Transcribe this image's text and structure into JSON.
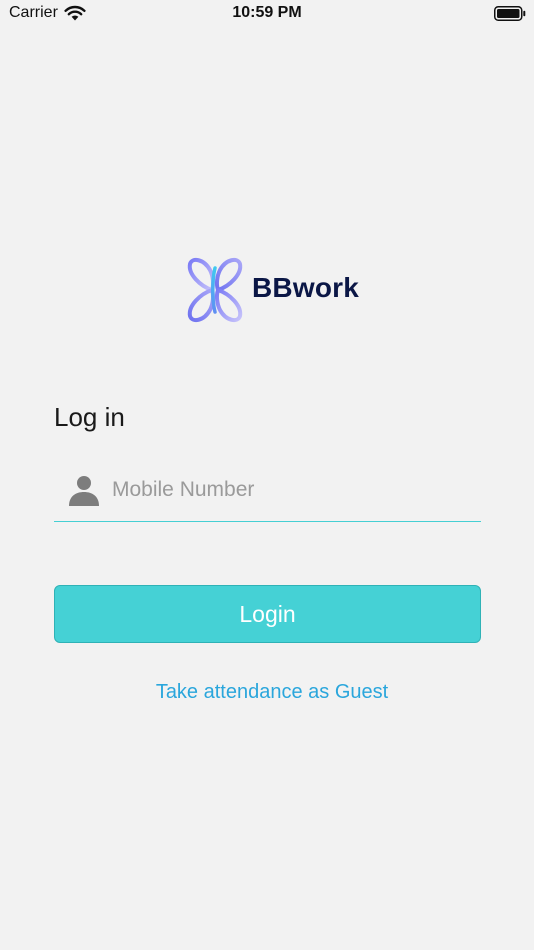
{
  "status_bar": {
    "carrier": "Carrier",
    "time": "10:59 PM"
  },
  "logo": {
    "text": "BBwork",
    "mark_colors": [
      "#7b7bf5",
      "#a9a6f7",
      "#3ec9f0"
    ]
  },
  "login": {
    "heading": "Log in",
    "mobile_placeholder": "Mobile Number",
    "mobile_value": "",
    "button_label": "Login",
    "guest_link": "Take attendance as Guest"
  },
  "colors": {
    "background": "#f2f2f2",
    "accent": "#45d1d5",
    "link": "#2aa6dc",
    "brand_text": "#0b1746"
  },
  "icons": {
    "field": "person-icon",
    "status": [
      "wifi-icon",
      "battery-icon"
    ]
  }
}
